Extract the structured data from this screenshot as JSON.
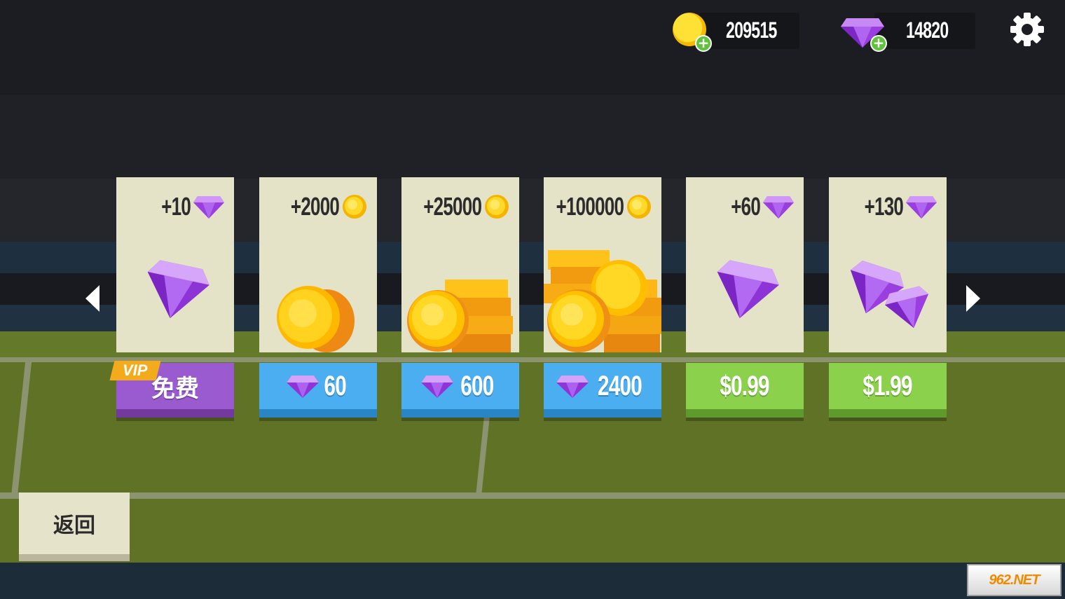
{
  "topbar": {
    "coins": {
      "value": "209515",
      "icon": "coin-icon",
      "add_icon": "plus-icon"
    },
    "gems": {
      "value": "14820",
      "icon": "gem-icon",
      "add_icon": "plus-icon"
    },
    "settings_icon": "gear-icon"
  },
  "navigation": {
    "prev_icon": "arrow-left-icon",
    "next_icon": "arrow-right-icon"
  },
  "shop": {
    "items": [
      {
        "amount": "+10",
        "currency_icon": "gem-icon",
        "art": "gem-single",
        "price": "免费",
        "price_icon": "",
        "button_color": "purple",
        "tag": "VIP"
      },
      {
        "amount": "+2000",
        "currency_icon": "coin-icon",
        "art": "coin-single",
        "price": "60",
        "price_icon": "gem-icon",
        "button_color": "blue"
      },
      {
        "amount": "+25000",
        "currency_icon": "coin-icon",
        "art": "coin-stack",
        "price": "600",
        "price_icon": "gem-icon",
        "button_color": "blue"
      },
      {
        "amount": "+100000",
        "currency_icon": "coin-icon",
        "art": "coin-pile",
        "price": "2400",
        "price_icon": "gem-icon",
        "button_color": "blue"
      },
      {
        "amount": "+60",
        "currency_icon": "gem-icon",
        "art": "gem-single",
        "price": "$0.99",
        "price_icon": "",
        "button_color": "green"
      },
      {
        "amount": "+130",
        "currency_icon": "gem-icon",
        "art": "gem-pair",
        "price": "$1.99",
        "price_icon": "",
        "button_color": "green"
      }
    ]
  },
  "back_button": {
    "label": "返回"
  },
  "watermark": {
    "text": "962.NET"
  },
  "colors": {
    "card": "#e4e2c7",
    "blue_button": "#4aaef0",
    "green_button": "#8bd14c",
    "purple_button": "#9b5bd0",
    "vip_tag": "#f4ab1b",
    "field": "#5f7226",
    "gem": "#a34ee6",
    "coin": "#ffd21f"
  }
}
